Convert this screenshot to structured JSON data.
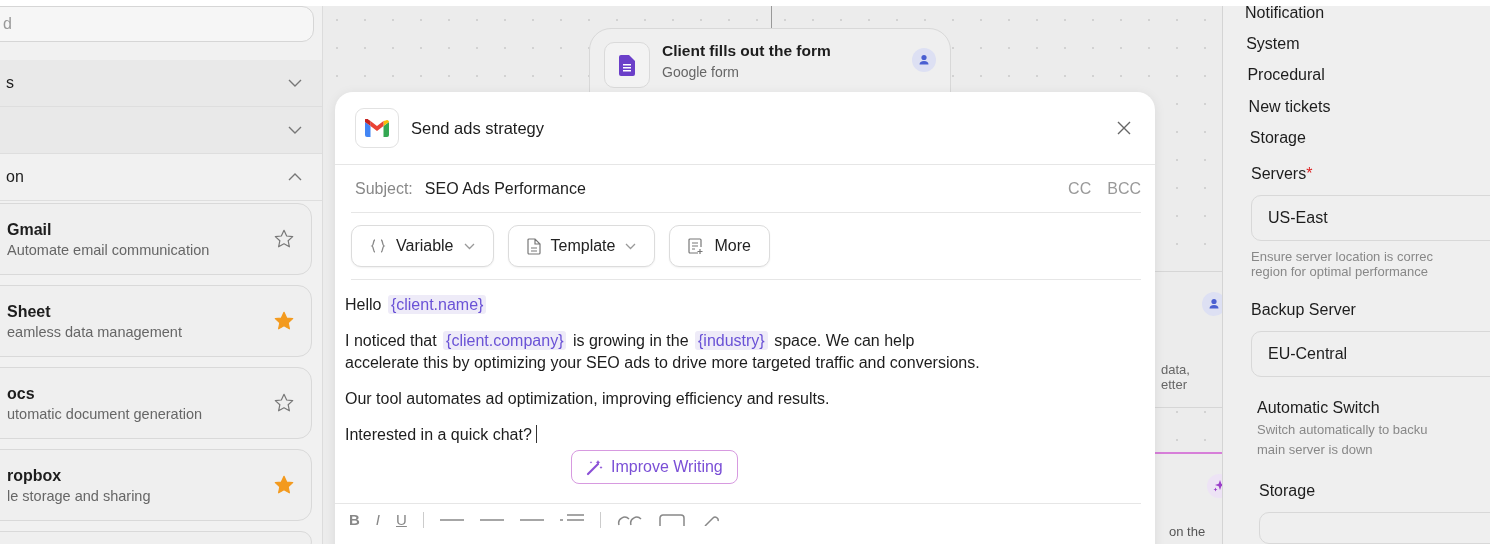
{
  "sidebar": {
    "search": {
      "placeholder": "d"
    },
    "sections": [
      {
        "label": "s",
        "expanded": false
      },
      {
        "expanded": false
      },
      {
        "label": "on",
        "expanded": true
      }
    ],
    "items": [
      {
        "name": "Gmail",
        "description": "Automate email communication",
        "starred": false
      },
      {
        "name": "Sheet",
        "description": "eamless data management",
        "starred": true
      },
      {
        "name": "ocs",
        "description": "utomatic document generation",
        "starred": false
      },
      {
        "name": "ropbox",
        "description": "le storage and sharing",
        "starred": true
      }
    ]
  },
  "canvas": {
    "nodes": [
      {
        "kind": "form",
        "title": "Client fills out the form",
        "subtitle": "Google form"
      }
    ],
    "side_node": {
      "lines": [
        "data,",
        "etter"
      ],
      "footer": "on the"
    }
  },
  "modal": {
    "title": "Send ads strategy",
    "subject_label": "Subject:",
    "subject": "SEO Ads Performance",
    "cc": "CC",
    "bcc": "BCC",
    "tools": [
      {
        "kind": "variable",
        "label": "Variable",
        "dropdown": true
      },
      {
        "kind": "template",
        "label": "Template",
        "dropdown": true
      },
      {
        "kind": "more",
        "label": "More",
        "dropdown": false
      }
    ],
    "paragraphs": [
      {
        "lines": [
          [
            {
              "kind": "text",
              "text": "Hello "
            },
            {
              "kind": "variable",
              "text": "{client.name}"
            }
          ]
        ],
        "cursor": false
      },
      {
        "lines": [
          [
            {
              "kind": "text",
              "text": "I noticed that "
            },
            {
              "kind": "variable",
              "text": "{client.company}"
            },
            {
              "kind": "text",
              "text": " is growing in the "
            },
            {
              "kind": "variable",
              "text": "{industry}"
            },
            {
              "kind": "text",
              "text": " space. We can help"
            }
          ],
          [
            {
              "kind": "text",
              "text": "accelerate this by optimizing your SEO ads to drive more targeted traffic and conversions."
            }
          ]
        ],
        "cursor": false
      },
      {
        "lines": [
          [
            {
              "kind": "text",
              "text": "Our tool automates ad optimization, improving efficiency and results."
            }
          ]
        ],
        "cursor": false
      },
      {
        "lines": [
          [
            {
              "kind": "text",
              "text": "Interested in a quick chat?"
            }
          ]
        ],
        "cursor": true
      }
    ],
    "improve_button": "Improve Writing",
    "format_bar": [
      "B",
      "I",
      "U"
    ]
  },
  "right_panel": {
    "nav": [
      "Notification",
      "System",
      "Procedural",
      "New tickets",
      "Storage"
    ],
    "fields": [
      {
        "label": "Servers",
        "required": true,
        "value": "US-East",
        "help": [
          "Ensure server location is correc",
          "region for optimal performance"
        ]
      },
      {
        "label": "Backup Server",
        "required": false,
        "value": "EU-Central"
      }
    ],
    "switch": {
      "label": "Automatic Switch",
      "description": [
        "Switch automatically to backu",
        "main server is down"
      ]
    },
    "storage_label": "Storage",
    "required_mark": "*"
  }
}
